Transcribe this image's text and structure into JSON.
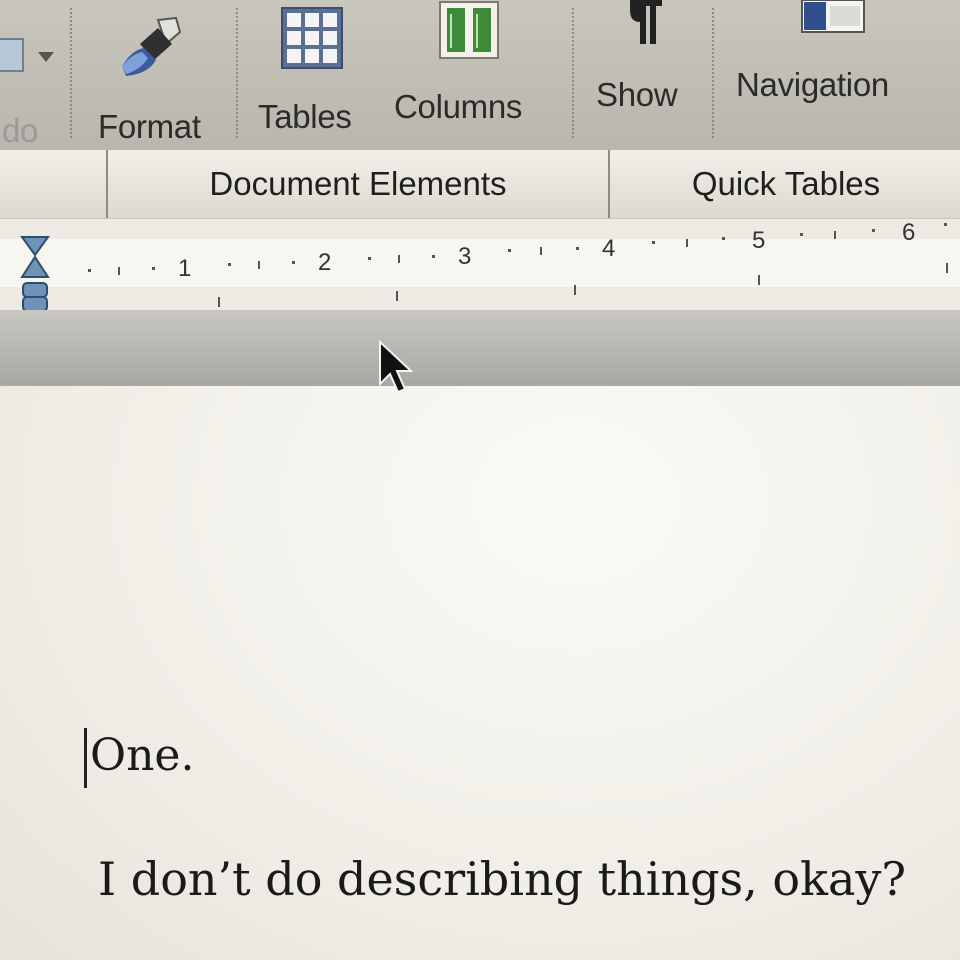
{
  "toolbar": {
    "undo_partial": "do",
    "format": "Format",
    "tables": "Tables",
    "columns": "Columns",
    "show": "Show",
    "navigation": "Navigation"
  },
  "ribbon": {
    "document_elements": "Document Elements",
    "quick_tables": "Quick Tables"
  },
  "ruler": {
    "numbers": [
      "1",
      "2",
      "3",
      "4",
      "5",
      "6"
    ]
  },
  "document": {
    "line1": "One.",
    "line2": "I don’t do describing things, okay?"
  },
  "icons": {
    "format": "paintbrush-icon",
    "tables": "table-grid-icon",
    "columns": "columns-icon",
    "show": "pilcrow-icon",
    "navigation": "sidebar-icon",
    "cursor": "mouse-pointer-icon"
  },
  "colors": {
    "toolbar_bg": "#c0bdb4",
    "page_bg": "#f4f2ec",
    "columns_green": "#3f8a3a",
    "table_blue": "#5b6f96"
  }
}
